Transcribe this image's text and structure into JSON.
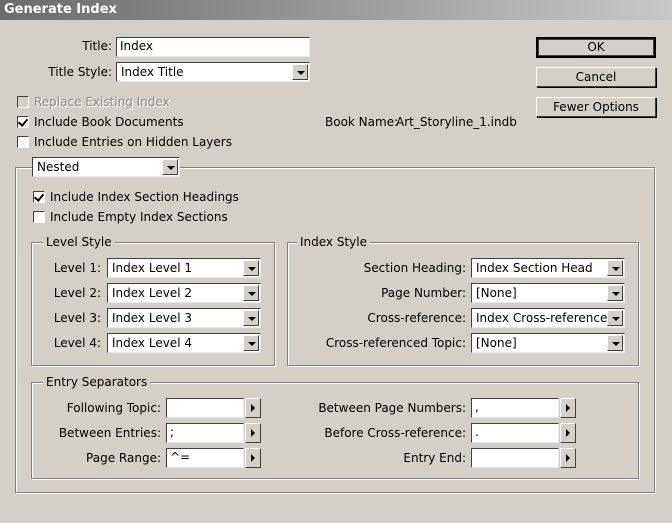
{
  "window": {
    "title": "Generate Index"
  },
  "title_field": {
    "label": "Title:",
    "value": "Index"
  },
  "title_style": {
    "label": "Title Style:",
    "value": "Index Title"
  },
  "buttons": {
    "ok": "OK",
    "cancel": "Cancel",
    "fewer_options": "Fewer Options"
  },
  "options": {
    "replace_existing": {
      "label": "Replace Existing Index",
      "checked": false,
      "disabled": true
    },
    "include_book_docs": {
      "label": "Include Book Documents",
      "checked": true
    },
    "include_hidden_layers": {
      "label": "Include Entries on Hidden Layers",
      "checked": false
    }
  },
  "book_name": {
    "label": "Book Name:",
    "value": "Art_Storyline_1.indb"
  },
  "format_select": {
    "value": "Nested"
  },
  "section_options": {
    "include_headings": {
      "label": "Include Index Section Headings",
      "checked": true
    },
    "include_empty": {
      "label": "Include Empty Index Sections",
      "checked": false
    }
  },
  "level_style": {
    "title": "Level Style",
    "levels": [
      {
        "label": "Level 1:",
        "value": "Index Level 1"
      },
      {
        "label": "Level 2:",
        "value": "Index Level 2"
      },
      {
        "label": "Level 3:",
        "value": "Index Level 3"
      },
      {
        "label": "Level 4:",
        "value": "Index Level 4"
      }
    ]
  },
  "index_style": {
    "title": "Index Style",
    "section_heading": {
      "label": "Section Heading:",
      "value": "Index Section Head"
    },
    "page_number": {
      "label": "Page Number:",
      "value": "[None]"
    },
    "cross_reference": {
      "label": "Cross-reference:",
      "value": "Index Cross-reference"
    },
    "cross_ref_topic": {
      "label": "Cross-referenced Topic:",
      "value": "[None]"
    }
  },
  "entry_separators": {
    "title": "Entry Separators",
    "following_topic": {
      "label": "Following Topic:",
      "value": ""
    },
    "between_entries": {
      "label": "Between Entries:",
      "value": ";"
    },
    "page_range": {
      "label": "Page Range:",
      "value": "^="
    },
    "between_page_numbers": {
      "label": "Between Page Numbers:",
      "value": ","
    },
    "before_cross_ref": {
      "label": "Before Cross-reference:",
      "value": "."
    },
    "entry_end": {
      "label": "Entry End:",
      "value": ""
    }
  }
}
